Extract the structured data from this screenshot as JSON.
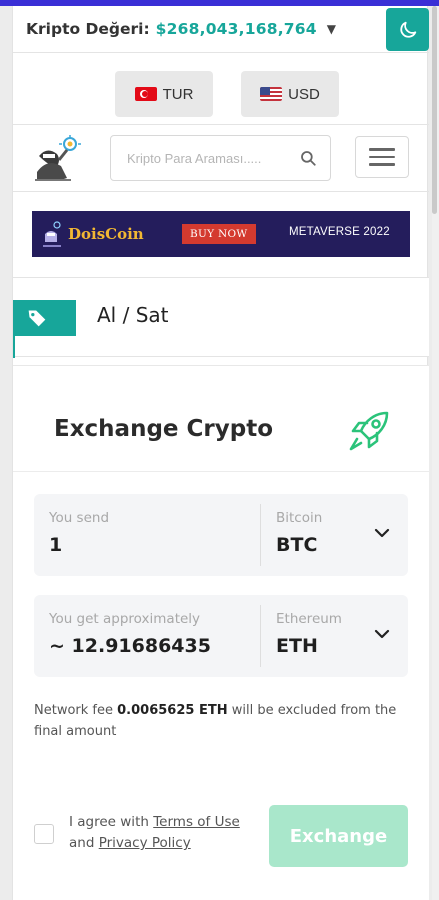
{
  "header": {
    "value_label": "Kripto Değeri:",
    "value_amount": "$268,043,168,764",
    "value_caret_icon": "caret-down-icon",
    "theme_icon": "moon-icon"
  },
  "switches": {
    "language": {
      "label": "TUR",
      "icon": "turkey-flag-icon"
    },
    "currency": {
      "label": "USD",
      "icon": "us-flag-icon"
    }
  },
  "nav": {
    "logo_icon": "mascot-logo-icon",
    "search_placeholder": "Kripto Para Araması.....",
    "search_icon": "search-icon",
    "menu_icon": "hamburger-menu-icon"
  },
  "banner": {
    "brand": "DoisCoin",
    "cta": "BUY NOW",
    "tagline": "METAVERSE 2022"
  },
  "section": {
    "icon": "tag-icon",
    "title": "Al / Sat"
  },
  "exchange": {
    "title": "Exchange Crypto",
    "title_icon": "rocket-icon",
    "send": {
      "caption": "You send",
      "amount": "1",
      "coin_name": "Bitcoin",
      "ticker": "BTC"
    },
    "get": {
      "caption": "You get approximately",
      "amount": "~ 12.91686435",
      "coin_name": "Ethereum",
      "ticker": "ETH"
    },
    "fee_prefix": "Network fee ",
    "fee_value": "0.0065625 ETH",
    "fee_suffix": " will be excluded from the final amount",
    "agree_prefix": "I agree with ",
    "terms_link": "Terms of Use",
    "agree_and": "and ",
    "privacy_link": "Privacy Policy",
    "button_label": "Exchange"
  },
  "colors": {
    "accent": "#17a69a",
    "top_bar": "#3a2fd6",
    "banner_bg": "#241d5c",
    "exchange_button": "#a9e7cb"
  }
}
